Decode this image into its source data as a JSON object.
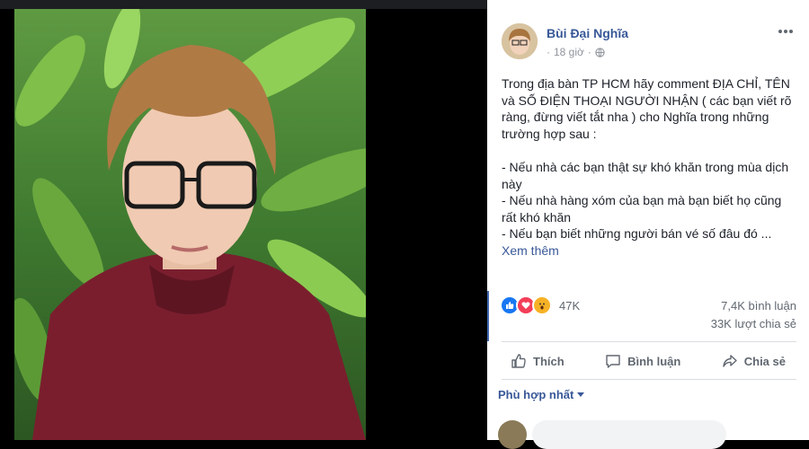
{
  "post": {
    "author": "Bùi Đại Nghĩa",
    "time": "18 giờ",
    "separator": "·",
    "text": "Trong địa bàn TP HCM hãy comment ĐỊA CHỈ, TÊN và SỐ ĐIỆN THOẠI NGƯỜI NHẬN ( các bạn viết rõ ràng, đừng viết tắt nha ) cho Nghĩa trong những trường hợp sau :\n\n- Nếu nhà các bạn thật sự khó khăn trong mùa dịch này\n- Nếu nhà hàng xóm của bạn mà bạn biết họ cũng rất khó khăn\n- Nếu bạn biết những người bán vé số đâu đó ...",
    "see_more": "Xem thêm"
  },
  "stats": {
    "reactions": "47K",
    "comments": "7,4K bình luận",
    "shares": "33K lượt chia sẻ"
  },
  "actions": {
    "like": "Thích",
    "comment": "Bình luận",
    "share": "Chia sẻ"
  },
  "comments": {
    "sort_label": "Phù hợp nhất"
  },
  "colors": {
    "link": "#385898",
    "like_blue": "#1877f2",
    "love_red": "#f33e58",
    "wow_yellow": "#f7b125"
  }
}
